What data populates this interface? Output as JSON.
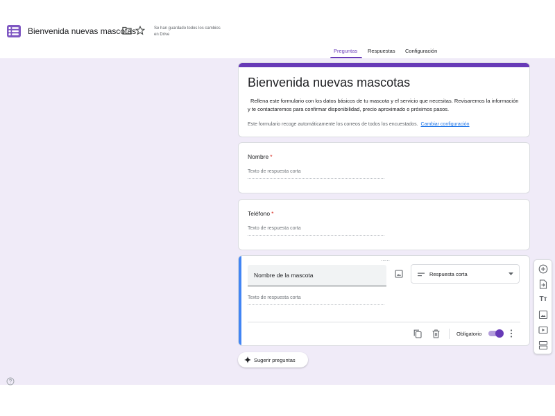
{
  "header": {
    "doc_title": "Bienvenida nuevas mascotas",
    "save_status": "Se han guardado todos los cambios en Drive"
  },
  "tabs": [
    {
      "label": "Preguntas",
      "active": true
    },
    {
      "label": "Respuestas",
      "active": false
    },
    {
      "label": "Configuración",
      "active": false
    }
  ],
  "form": {
    "title": "Bienvenida nuevas mascotas",
    "description": "Rellena este formulario con los datos básicos de tu mascota y el servicio que necesitas. Revisaremos la información y te contactaremos para confirmar disponibilidad, precio aproximado o próximos pasos.",
    "email_note": "Este formulario recoge automáticamente los correos de todos los encuestados.",
    "change_settings_link": "Cambiar configuración"
  },
  "questions": [
    {
      "title": "Nombre",
      "required_mark": "*",
      "placeholder": "Texto de respuesta corta"
    },
    {
      "title": "Teléfono",
      "required_mark": "*",
      "placeholder": "Texto de respuesta corta"
    },
    {
      "title": "Nombre de la mascota",
      "type": "Respuesta corta",
      "placeholder": "Texto de respuesta corta",
      "required_label": "Obligatorio",
      "required": true,
      "drag_handle": "⋯⋯"
    }
  ],
  "suggest_button": "Sugerir preguntas",
  "colors": {
    "accent": "#673ab7",
    "active_border": "#4285f4",
    "canvas": "#f0ebf8",
    "required": "#d93025",
    "link": "#1a73e8"
  },
  "toolbar_icons": [
    "add-question-icon",
    "import-questions-icon",
    "add-title-icon",
    "add-image-icon",
    "add-video-icon",
    "add-section-icon"
  ],
  "icons": [
    "forms-app-icon",
    "folder-icon",
    "star-icon",
    "help-icon",
    "image-icon",
    "short-text-icon",
    "dropdown-caret-icon",
    "duplicate-icon",
    "delete-icon",
    "more-vert-icon",
    "sparkle-icon"
  ]
}
